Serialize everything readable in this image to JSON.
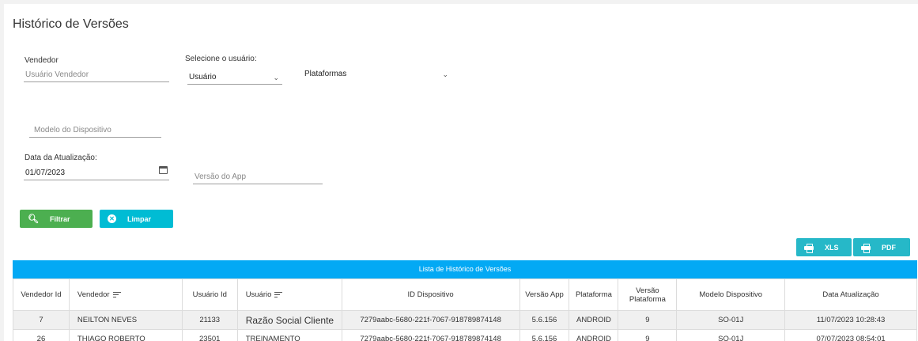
{
  "page": {
    "title": "Histórico de Versões"
  },
  "filters": {
    "vendedor": {
      "label": "Vendedor",
      "placeholder": "Usuário Vendedor"
    },
    "usuario": {
      "label": "Selecione o usuário:",
      "value": "Usuário"
    },
    "plataforma": {
      "value": "Plataformas"
    },
    "modelo": {
      "placeholder": "Modelo do Dispositivo"
    },
    "data": {
      "label": "Data da Atualização:",
      "value": "01/07/2023"
    },
    "versao_app": {
      "placeholder": "Versão do App"
    }
  },
  "actions": {
    "filter_label": "Filtrar",
    "clear_label": "Limpar"
  },
  "export": {
    "xls_label": "XLS",
    "pdf_label": "PDF"
  },
  "table": {
    "caption": "Lista de Histórico de Versões",
    "columns": [
      "Vendedor Id",
      "Vendedor",
      "Usuário Id",
      "Usuário",
      "ID Dispositivo",
      "Versão App",
      "Plataforma",
      "Versão Plataforma",
      "Modelo Dispositivo",
      "Data Atualização"
    ],
    "rows": [
      [
        "7",
        "NEILTON NEVES",
        "21133",
        "Razão Social Cliente",
        "7279aabc-5680-221f-7067-918789874148",
        "5.6.156",
        "ANDROID",
        "9",
        "SO-01J",
        "11/07/2023 10:28:43"
      ],
      [
        "26",
        "THIAGO ROBERTO",
        "23501",
        "TREINAMENTO",
        "7279aabc-5680-221f-7067-918789874148",
        "5.6.156",
        "ANDROID",
        "9",
        "SO-01J",
        "07/07/2023 08:54:01"
      ]
    ]
  },
  "colors": {
    "table_header": "#03a9f4",
    "filter_button": "#4caf50",
    "clear_button": "#00bcd4"
  },
  "icons": {
    "filter": "search-icon",
    "clear": "close-circle-icon",
    "export": "printer-icon",
    "date": "calendar-icon",
    "select": "chevron-down-icon",
    "sort": "sort-icon"
  }
}
